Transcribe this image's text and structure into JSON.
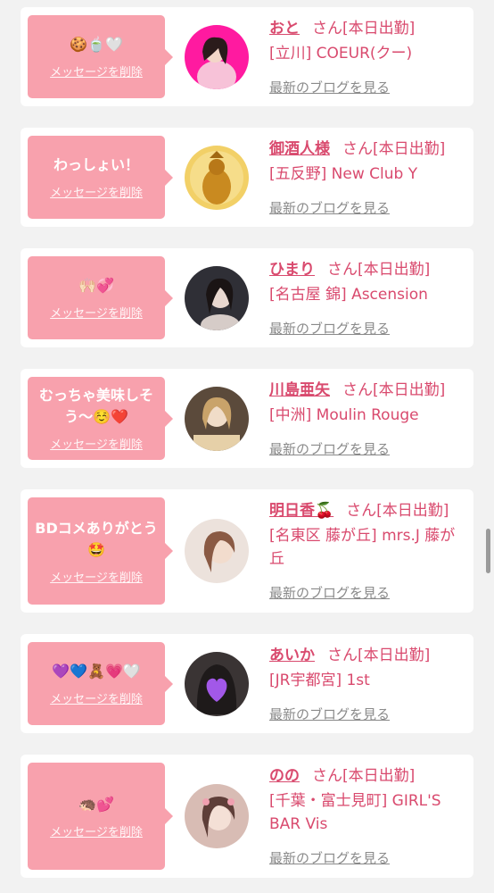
{
  "delete_label": "メッセージを削除",
  "blog_label": "最新のブログを見る",
  "items": [
    {
      "message": "🍪🍵🤍",
      "name": "おと",
      "suffix": "さん[本日出勤]",
      "shop": "[立川] COEUR(クー)",
      "avatar_colors": [
        "#ff1aa0",
        "#f07ab8"
      ]
    },
    {
      "message": "わっしょい！",
      "name": "御酒人様",
      "suffix": "さん[本日出勤]",
      "shop": "[五反野] New Club Y",
      "avatar_colors": [
        "#f6d36b",
        "#c58a1e"
      ]
    },
    {
      "message": "🙌🏻💞",
      "name": "ひまり",
      "suffix": "さん[本日出勤]",
      "shop": "[名古屋 錦] Ascension",
      "avatar_colors": [
        "#3a3a40",
        "#cfc6c2"
      ]
    },
    {
      "message": "むっちゃ美味しそう〜☺️❤️",
      "name": "川島亜矢",
      "suffix": "さん[本日出勤]",
      "shop": "[中洲] Moulin Rouge",
      "avatar_colors": [
        "#5a4a3a",
        "#d8c2a0"
      ]
    },
    {
      "message": "BDコメありがとう🤩",
      "name": "明日香🍒",
      "suffix": "さん[本日出勤]",
      "shop": "[名東区 藤が丘] mrs.J 藤が丘",
      "avatar_colors": [
        "#e8dcd6",
        "#b58c78"
      ]
    },
    {
      "message": "💜💙🧸💗🤍",
      "name": "あいか",
      "suffix": "さん[本日出勤]",
      "shop": "[JR宇都宮] 1st",
      "avatar_colors": [
        "#2a2a2a",
        "#7a6a66"
      ]
    },
    {
      "message": "🦔💕",
      "name": "のの",
      "suffix": "さん[本日出勤]",
      "shop": "[千葉・富士見町] GIRL'S BAR Vis",
      "avatar_colors": [
        "#d9b8b0",
        "#6a4a44"
      ]
    }
  ]
}
